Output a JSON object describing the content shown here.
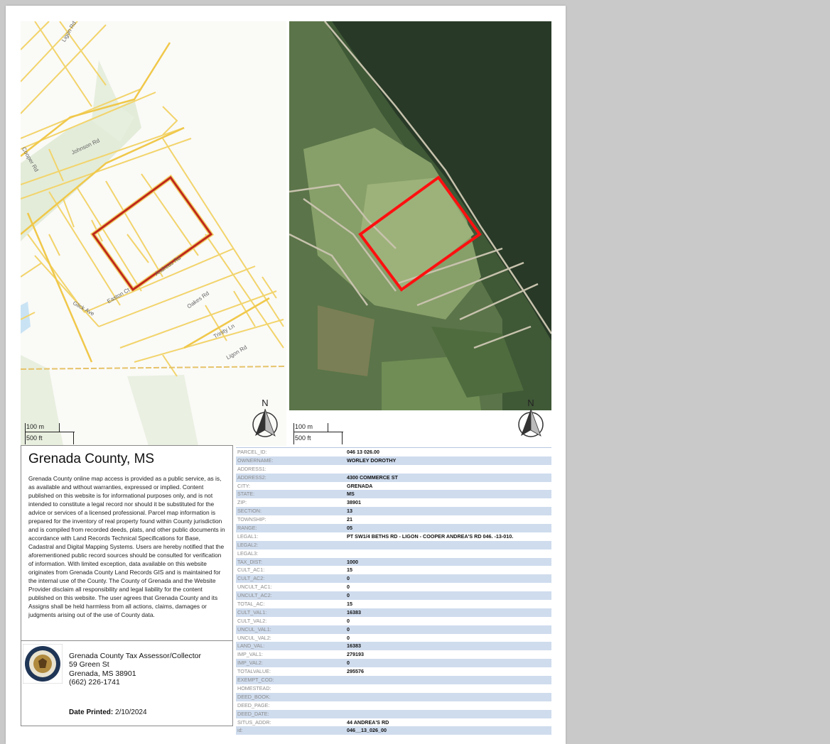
{
  "map_left": {
    "road_labels": [
      "Ligon Rd",
      "Johnson Rd",
      "Cooper Rd",
      "Andreas Rd",
      "Trinity Ln",
      "Oakes Rd",
      "Easton Ct",
      "Glick Ave",
      "Ligon Rd"
    ],
    "scale": {
      "metric": "100 m",
      "imperial": "500 ft"
    },
    "north_label": "N",
    "colors": {
      "parcel_lines": "#f2d46b",
      "subject_parcel": "#c0291b",
      "background": "#fafaf7"
    }
  },
  "map_right": {
    "scale": {
      "metric": "100 m",
      "imperial": "500 ft"
    },
    "north_label": "N",
    "colors": {
      "subject_parcel": "#ff1010"
    }
  },
  "info": {
    "county_title": "Grenada County, MS",
    "disclaimer": "Grenada County online map access is provided as a public service, as is, as available and without warranties, expressed or implied. Content published on this website is for informational purposes only, and is not intended to constitute a legal record nor should it be substituted for the advice or services of a licensed professional. Parcel map information is prepared for the inventory of real property found within County jurisdiction and is compiled from recorded deeds, plats, and other public documents in accordance with Land Records Technical Specifications for Base, Cadastral and Digital Mapping Systems. Users are hereby notified that the aforementioned public record sources should be consulted for verification of information. With limited exception, data available on this website originates from Grenada County Land Records GIS and is maintained for the internal use of the County. The County of Grenada and the Website Provider disclaim all responsibility and legal liability for the content published on this website. The user agrees that Grenada County and its Assigns shall be held harmless from all actions, claims, damages or judgments arising out of the use of County data.",
    "office_name": "Grenada County Tax Assessor/Collector",
    "street": "59 Green St",
    "city_line": "Grenada, MS 38901",
    "phone": "(662) 226-1741",
    "printed_label": "Date Printed:",
    "printed_date": "2/10/2024"
  },
  "attributes": [
    {
      "k": "PARCEL_ID:",
      "v": "046 13 026.00"
    },
    {
      "k": "OWNERNAME:",
      "v": "WORLEY DOROTHY"
    },
    {
      "k": "ADDRESS1:",
      "v": ""
    },
    {
      "k": "ADDRESS2:",
      "v": "4300 COMMERCE ST"
    },
    {
      "k": "CITY:",
      "v": "GRENADA"
    },
    {
      "k": "STATE:",
      "v": "MS"
    },
    {
      "k": "ZIP:",
      "v": "38901"
    },
    {
      "k": "SECTION:",
      "v": "13"
    },
    {
      "k": "TOWNSHIP:",
      "v": "21"
    },
    {
      "k": "RANGE:",
      "v": "05"
    },
    {
      "k": "LEGAL1:",
      "v": "PT SW1/4 BETHS RD - LIGON - COOPER ANDREA'S RD 046. -13-010."
    },
    {
      "k": "LEGAL2:",
      "v": ""
    },
    {
      "k": "LEGAL3:",
      "v": ""
    },
    {
      "k": "TAX_DIST:",
      "v": "1000"
    },
    {
      "k": "CULT_AC1:",
      "v": "15"
    },
    {
      "k": "CULT_AC2:",
      "v": "0"
    },
    {
      "k": "UNCULT_AC1:",
      "v": "0"
    },
    {
      "k": "UNCULT_AC2:",
      "v": "0"
    },
    {
      "k": "TOTAL_AC:",
      "v": "15"
    },
    {
      "k": "CULT_VAL1:",
      "v": "16383"
    },
    {
      "k": "CULT_VAL2:",
      "v": "0"
    },
    {
      "k": "UNCUL_VAL1:",
      "v": "0"
    },
    {
      "k": "UNCUL_VAL2:",
      "v": "0"
    },
    {
      "k": "LAND_VAL:",
      "v": "16383"
    },
    {
      "k": "IMP_VAL1:",
      "v": "279193"
    },
    {
      "k": "IMP_VAL2:",
      "v": "0"
    },
    {
      "k": "TOTALVALUE:",
      "v": "295576"
    },
    {
      "k": "EXEMPT_COD:",
      "v": ""
    },
    {
      "k": "HOMESTEAD:",
      "v": ""
    },
    {
      "k": "DEED_BOOK:",
      "v": ""
    },
    {
      "k": "DEED_PAGE:",
      "v": ""
    },
    {
      "k": "DEED_DATE:",
      "v": ""
    },
    {
      "k": "SITUS_ADDR:",
      "v": "44 ANDREA'S RD"
    },
    {
      "k": "id:",
      "v": "046__13_026_00"
    }
  ]
}
